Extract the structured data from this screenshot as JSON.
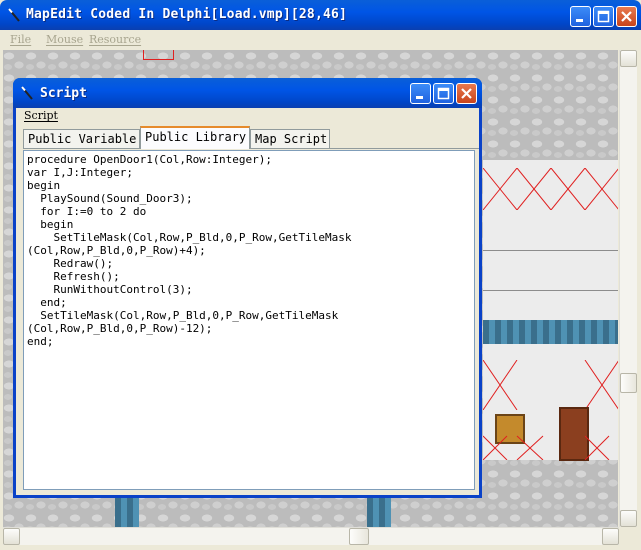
{
  "main": {
    "title": "MapEdit Coded In Delphi[Load.vmp][28,46]",
    "menu": [
      "File",
      "Mouse",
      "Resource"
    ]
  },
  "script_window": {
    "title": "Script",
    "menu": [
      "Script"
    ],
    "tabs": [
      "Public Variable",
      "Public Library",
      "Map Script"
    ],
    "active_tab": "Public Library",
    "code": "procedure OpenDoor1(Col,Row:Integer);\nvar I,J:Integer;\nbegin\n  PlaySound(Sound_Door3);\n  for I:=0 to 2 do\n  begin\n    SetTileMask(Col,Row,P_Bld,0,P_Row,GetTileMask\n(Col,Row,P_Bld,0,P_Row)+4);\n    Redraw();\n    Refresh();\n    RunWithoutControl(3);\n  end;\n  SetTileMask(Col,Row,P_Bld,0,P_Row,GetTileMask\n(Col,Row,P_Bld,0,P_Row)-12);\nend;"
  },
  "colors": {
    "titlebar": "#0055e6",
    "close_button": "#d9562b",
    "active_tab_accent": "#e68b2c",
    "marker_red": "#e02020"
  },
  "icons": [
    "wand-icon",
    "minimize-icon",
    "maximize-icon",
    "close-icon"
  ]
}
